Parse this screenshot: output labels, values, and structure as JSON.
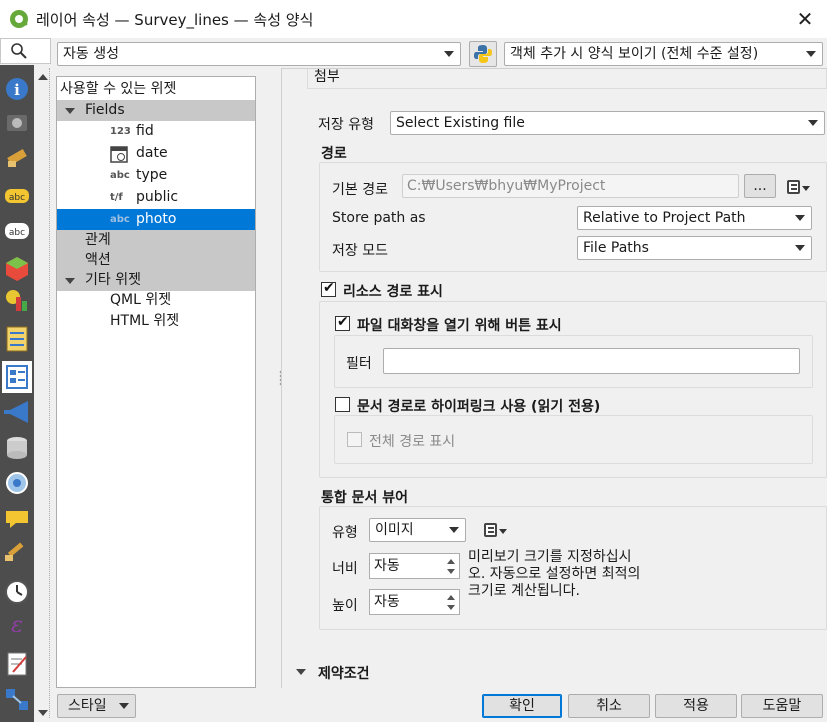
{
  "window": {
    "title": "레이어 속성 — Survey_lines — 속성 양식",
    "close_symbol": "✕"
  },
  "top_bar": {
    "layout_combo": "자동 생성",
    "python_icon": "python-icon",
    "form_suppress_combo": "객체 추가 시 양식 보이기 (전체 수준 설정)"
  },
  "tree": {
    "header": "사용할 수 있는 위젯",
    "items": [
      {
        "label": "Fields",
        "type_tag": ""
      },
      {
        "label": "fid",
        "type_tag": "123"
      },
      {
        "label": "date",
        "type_tag": ""
      },
      {
        "label": "type",
        "type_tag": "abc"
      },
      {
        "label": "public",
        "type_tag": "t/f"
      },
      {
        "label": "photo",
        "type_tag": "abc"
      },
      {
        "label": "관계",
        "type_tag": ""
      },
      {
        "label": "액션",
        "type_tag": ""
      },
      {
        "label": "기타 위젯",
        "type_tag": ""
      },
      {
        "label": "QML 위젯",
        "type_tag": ""
      },
      {
        "label": "HTML 위젯",
        "type_tag": ""
      }
    ]
  },
  "editor": {
    "section_attachment": "첨부",
    "storage_type_label": "저장 유형",
    "storage_type_value": "Select Existing file",
    "path_section": "경로",
    "default_path_label": "기본 경로",
    "default_path_value": "C:₩Users₩bhyu₩MyProject",
    "browse_label": "...",
    "store_path_as_label": "Store path as",
    "store_path_as_value": "Relative to Project Path",
    "storage_mode_label": "저장 모드",
    "storage_mode_value": "File Paths",
    "show_resource_path": "리소스 경로 표시",
    "show_button_label": "파일 대화창을 열기 위해 버튼 표시",
    "filter_label": "필터",
    "filter_value": "",
    "hyperlink_label": "문서 경로로 하이퍼링크 사용 (읽기 전용)",
    "full_path_label": "전체 경로 표시",
    "viewer_section": "통합 문서 뷰어",
    "viewer_type_label": "유형",
    "viewer_type_value": "이미지",
    "width_label": "너비",
    "width_value": "자동",
    "height_label": "높이",
    "height_value": "자동",
    "size_hint": "미리보기 크기를 지정하십시오. 자동으로 설정하면 최적의 크기로 계산됩니다.",
    "constraints_section": "제약조건"
  },
  "footer": {
    "style_button": "스타일",
    "ok": "확인",
    "cancel": "취소",
    "apply": "적용",
    "help": "도움말"
  },
  "sidebar_icons": [
    "information-icon",
    "source-icon",
    "symbology-icon",
    "labels-icon",
    "masks-icon",
    "3d-view-icon",
    "diagrams-icon",
    "fields-icon",
    "attributes-form-icon",
    "joins-icon",
    "auxiliary-storage-icon",
    "actions-icon",
    "display-icon",
    "rendering-icon",
    "temporal-icon",
    "variables-icon",
    "metadata-icon",
    "dependencies-icon"
  ]
}
